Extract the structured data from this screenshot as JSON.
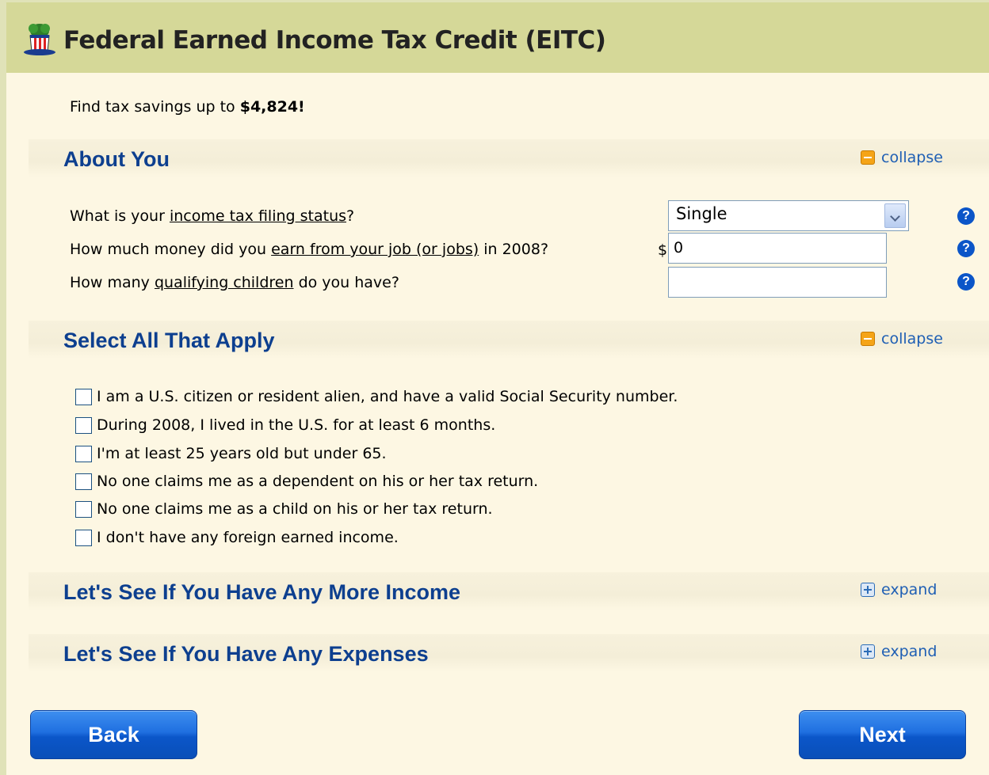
{
  "header": {
    "title": "Federal Earned Income Tax Credit (EITC)",
    "logo": "uncle-sam-hat-icon"
  },
  "intro": {
    "text": "Find tax savings up to ",
    "amount": "$4,824!"
  },
  "sections": {
    "about": {
      "title": "About You",
      "toggle": "collapse"
    },
    "select": {
      "title": "Select All That Apply",
      "toggle": "collapse"
    },
    "income": {
      "title": "Let's See If You Have Any More Income",
      "toggle": "expand"
    },
    "expenses": {
      "title": "Let's See If You Have Any Expenses",
      "toggle": "expand"
    }
  },
  "questions": {
    "filing": {
      "pre": "What is your ",
      "link": "income tax filing status",
      "post": "?",
      "value": "Single"
    },
    "earnings": {
      "pre": "How much money did you ",
      "link": "earn from your job (or jobs)",
      "post": " in 2008?",
      "currency": "$",
      "value": "0"
    },
    "children": {
      "pre": "How many ",
      "link": "qualifying children",
      "post": " do you have?",
      "value": ""
    }
  },
  "checklist": [
    "I am a U.S. citizen or resident alien, and have a valid Social Security number.",
    "During 2008, I lived in the U.S. for at least 6 months.",
    "I'm at least 25 years old but under 65.",
    "No one claims me as a dependent on his or her tax return.",
    "No one claims me as a child on his or her tax return.",
    "I don't have any foreign earned income."
  ],
  "buttons": {
    "back": "Back",
    "next": "Next"
  },
  "help_label": "?",
  "colors": {
    "header_bg": "#d5d898",
    "section_title": "#0d3f8f",
    "link": "#1f5fb4",
    "button": "#0b56c9"
  }
}
